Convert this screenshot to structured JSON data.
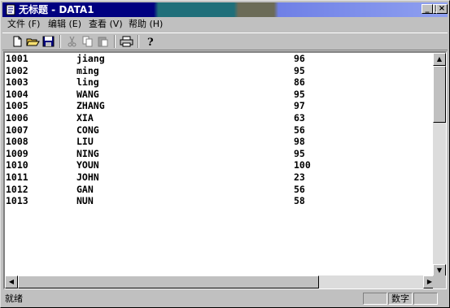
{
  "window": {
    "title": "无标题 - DATA1"
  },
  "title_buttons": {
    "minimize": "_",
    "maximize": "□",
    "close": "×"
  },
  "menu": [
    {
      "label": "文件 (F)"
    },
    {
      "label": "编辑 (E)"
    },
    {
      "label": "查看 (V)"
    },
    {
      "label": "帮助 (H)"
    }
  ],
  "toolbar": [
    "new-file-icon",
    "open-folder-icon",
    "save-icon",
    "cut-icon",
    "copy-icon",
    "paste-icon",
    "print-icon",
    "help-icon"
  ],
  "rows": [
    {
      "id": "1001",
      "name": "jiang",
      "score": "96"
    },
    {
      "id": "1002",
      "name": "ming",
      "score": "95"
    },
    {
      "id": "1003",
      "name": "ling",
      "score": "86"
    },
    {
      "id": "1004",
      "name": "WANG",
      "score": "95"
    },
    {
      "id": "1005",
      "name": "ZHANG",
      "score": "97"
    },
    {
      "id": "1006",
      "name": "XIA",
      "score": "63"
    },
    {
      "id": "1007",
      "name": "CONG",
      "score": "56"
    },
    {
      "id": "1008",
      "name": "LIU",
      "score": "98"
    },
    {
      "id": "1009",
      "name": "NING",
      "score": "95"
    },
    {
      "id": "1010",
      "name": "YOUN",
      "score": "100"
    },
    {
      "id": "1011",
      "name": "JOHN",
      "score": "23"
    },
    {
      "id": "1012",
      "name": "GAN",
      "score": "56"
    },
    {
      "id": "1013",
      "name": "NUN",
      "score": "58"
    }
  ],
  "status": {
    "text": "就绪",
    "num": "数字"
  }
}
